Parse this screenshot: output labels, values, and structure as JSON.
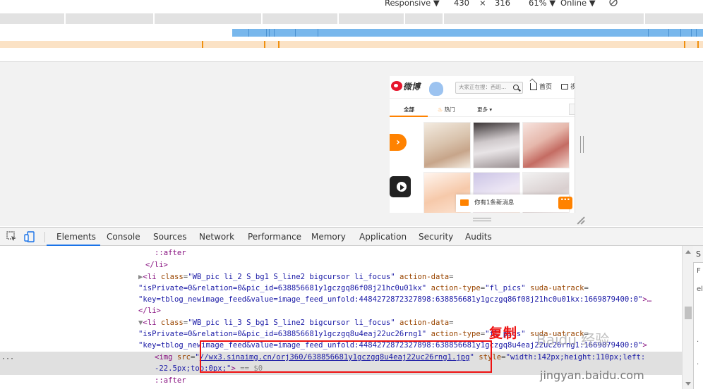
{
  "device_toolbar": {
    "mode": "Responsive",
    "width": "430",
    "times": "×",
    "height": "316",
    "zoom": "61%",
    "network": "Online",
    "caret": "▼"
  },
  "phone": {
    "logo": "微博",
    "search_placeholder": "大家正在搜：西班...",
    "home_label": "首页",
    "video_label": "视",
    "tabs": [
      "全部",
      "热门",
      "更多"
    ],
    "more_caret": "▾",
    "arrow": "›",
    "toast": "你有1条新消息"
  },
  "devtools": {
    "tabs": [
      "Elements",
      "Console",
      "Sources",
      "Network",
      "Performance",
      "Memory",
      "Application",
      "Security",
      "Audits"
    ],
    "side_s": "S",
    "side_f": "F",
    "side_el": "el",
    "side_dot": ".",
    "side_dot2": ".",
    "ellipsis": "···",
    "dom": {
      "l1_pseudo": "::after",
      "l2_close": "</li>",
      "l3_open": "<li ",
      "l3_class_attr": "class",
      "l3_class_val": "\"WB_pic li_2 S_bg1 S_line2 bigcursor li_focus\"",
      "l3_ad_attr": "action-data",
      "l4_ad_val": "\"isPrivate=0&relation=0&pic_id=638856681y1gczgq86f08j21hc0u01kx\"",
      "l4_at_attr": "action-type",
      "l4_at_val": "\"fl_pics\"",
      "l4_su_attr": "suda-uatrack",
      "l5_su_val": "\"key=tblog_newimage_feed&value=image_feed_unfold:4484272872327898:638856681y1gczgq86f08j21hc0u01kx:1669879400:0\"",
      "l5_end": ">…",
      "l6_close": "</li>",
      "l7_class_val": "\"WB_pic li_3 S_bg1 S_line2 bigcursor li_focus\"",
      "l8_ad_val": "\"isPrivate=0&relation=0&pic_id=638856681y1gczgq8u4eaj22uc26rng1\"",
      "l8_at_val": "\"fl_pics\"",
      "l9_su_val": "\"key=tblog_newimage_feed&value=image_feed_unfold:4484272872327898:638856681y1gczgq8u4eaj22uc26rng1:1669879400:0\"",
      "l9_end": ">",
      "img_open": "<img ",
      "img_src_attr": "src",
      "img_src_val": "//wx3.sinaimg.cn/orj360/638856681y1gczgq8u4eaj22uc26rng1.jpg",
      "img_style_attr": "style",
      "img_style_val": "\"width:142px;height:110px;left:",
      "img_style_cont": "-22.5px;top:0px;\"",
      "img_end": ">",
      "img_dollar": "== $0",
      "l12_pseudo": "::after"
    }
  },
  "annotation": {
    "copy_label": "复制",
    "watermark": "Baidu 经验",
    "watermark_url": "jingyan.baidu.com"
  }
}
